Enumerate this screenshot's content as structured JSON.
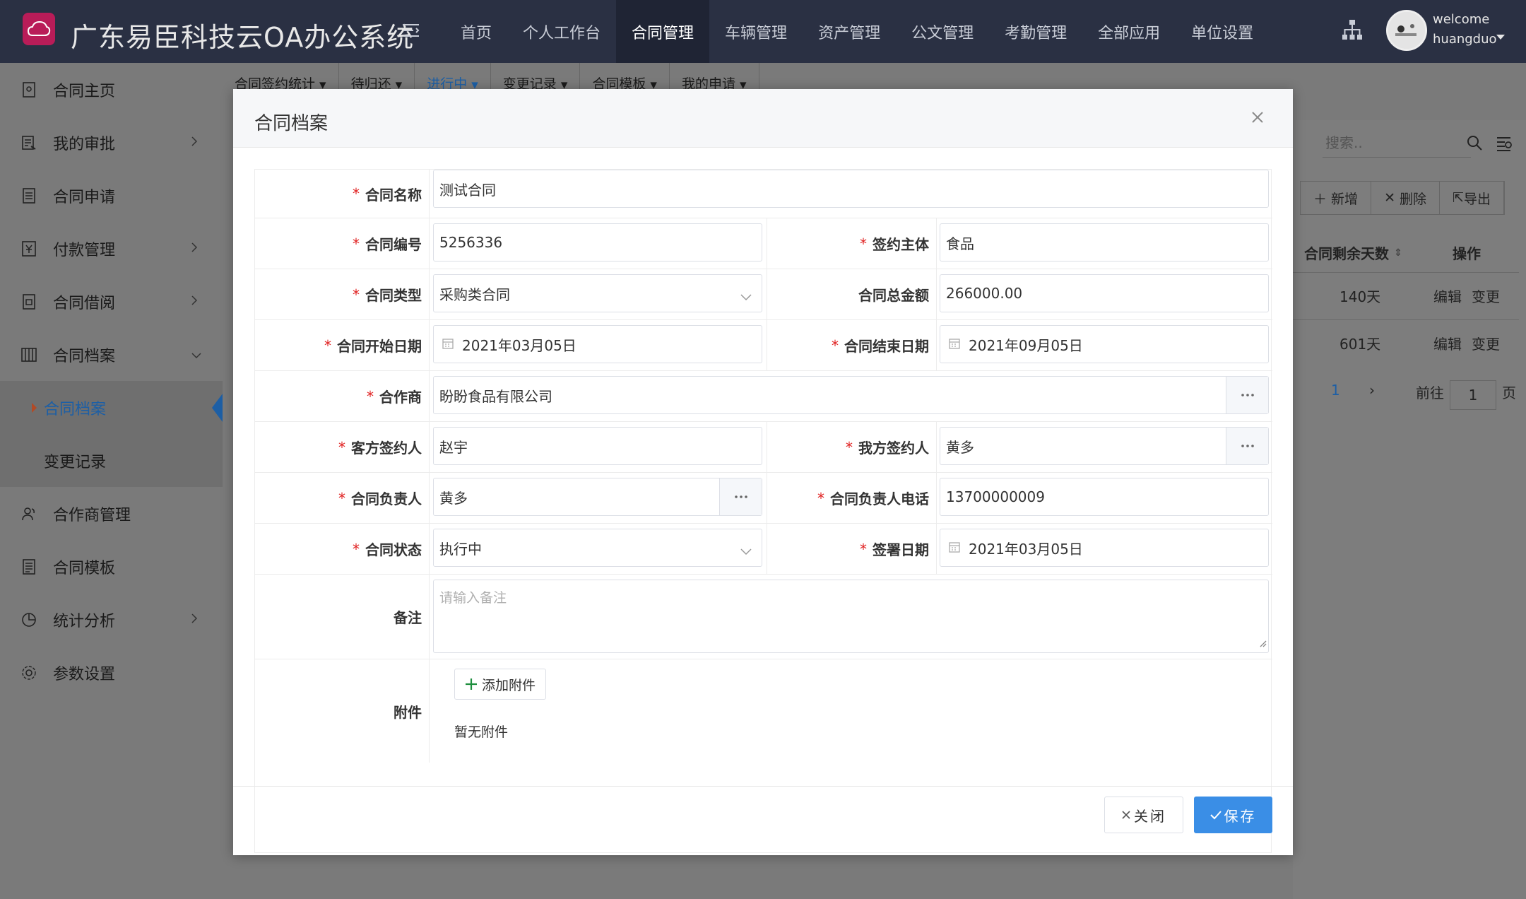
{
  "header": {
    "app_title": "广东易臣科技云OA办公系统",
    "nav": [
      "首页",
      "个人工作台",
      "合同管理",
      "车辆管理",
      "资产管理",
      "公文管理",
      "考勤管理",
      "全部应用",
      "单位设置"
    ],
    "user": {
      "greeting": "welcome",
      "name": "huangduo"
    }
  },
  "sidebar": {
    "items": [
      {
        "label": "合同主页",
        "icon": "contract-home-icon"
      },
      {
        "label": "我的审批",
        "icon": "approval-icon"
      },
      {
        "label": "合同申请",
        "icon": "apply-icon"
      },
      {
        "label": "付款管理",
        "icon": "payment-icon"
      },
      {
        "label": "合同借阅",
        "icon": "borrow-icon"
      },
      {
        "label": "合同档案",
        "icon": "archive-icon"
      },
      {
        "label": "合作商管理",
        "icon": "partner-icon"
      },
      {
        "label": "合同模板",
        "icon": "template-icon"
      },
      {
        "label": "统计分析",
        "icon": "stats-icon"
      },
      {
        "label": "参数设置",
        "icon": "settings-icon"
      }
    ],
    "sub_items": [
      "合同档案",
      "变更记录"
    ]
  },
  "background": {
    "tabs": [
      "合同签约统计",
      "待归还",
      "进行中",
      "变更记录",
      "合同模板",
      "我的申请"
    ],
    "search_placeholder": "搜索..",
    "buttons": [
      "新增",
      "删除",
      "导出"
    ],
    "table": {
      "headers": [
        "合同剩余天数",
        "操作"
      ],
      "rows": [
        {
          "days": "140天",
          "actions": [
            "编辑",
            "变更"
          ]
        },
        {
          "days": "601天",
          "actions": [
            "编辑",
            "变更"
          ]
        }
      ]
    },
    "pager": {
      "current": "1",
      "goto_label": "前往",
      "page_value": "1",
      "page_suffix": "页"
    }
  },
  "modal": {
    "title": "合同档案",
    "fields": {
      "name": {
        "label": "合同名称",
        "value": "测试合同"
      },
      "number": {
        "label": "合同编号",
        "value": "5256336"
      },
      "signing_party": {
        "label": "签约主体",
        "value": "食品"
      },
      "type": {
        "label": "合同类型",
        "value": "采购类合同"
      },
      "amount": {
        "label": "合同总金额",
        "value": "266000.00"
      },
      "start_date": {
        "label": "合同开始日期",
        "value": "2021年03月05日"
      },
      "end_date": {
        "label": "合同结束日期",
        "value": "2021年09月05日"
      },
      "partner": {
        "label": "合作商",
        "value": "盼盼食品有限公司"
      },
      "client_signer": {
        "label": "客方签约人",
        "value": "赵宇"
      },
      "our_signer": {
        "label": "我方签约人",
        "value": "黄多"
      },
      "manager": {
        "label": "合同负责人",
        "value": "黄多"
      },
      "manager_phone": {
        "label": "合同负责人电话",
        "value": "13700000009"
      },
      "status": {
        "label": "合同状态",
        "value": "执行中"
      },
      "sign_date": {
        "label": "签署日期",
        "value": "2021年03月05日"
      },
      "remark": {
        "label": "备注",
        "placeholder": "请输入备注"
      },
      "attachment": {
        "label": "附件",
        "button": "添加附件",
        "empty": "暂无附件"
      }
    },
    "footer": {
      "close": "关闭",
      "save": "保存"
    }
  }
}
